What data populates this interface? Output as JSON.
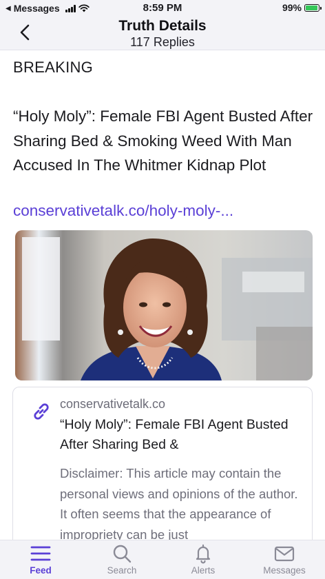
{
  "status_bar": {
    "back_app": "Messages",
    "time": "8:59 PM",
    "battery": "99%"
  },
  "header": {
    "title": "Truth Details",
    "subtitle": "117 Replies"
  },
  "post": {
    "breaking": "BREAKING",
    "headline": "“Holy Moly”: Female FBI Agent Busted After Sharing Bed & Smoking Weed With Man Accused In The Whitmer Kidnap Plot",
    "link_text": "conservativetalk.co/holy-moly-..."
  },
  "link_card": {
    "domain": "conservativetalk.co",
    "title": "“Holy Moly”: Female FBI Agent Busted After Sharing Bed &",
    "description": "Disclaimer: This article may contain the personal views and opinions of the author. It often seems that the appearance of impropriety can be just"
  },
  "tabs": [
    {
      "label": "Feed",
      "icon": "feed-icon",
      "active": true
    },
    {
      "label": "Search",
      "icon": "search-icon",
      "active": false
    },
    {
      "label": "Alerts",
      "icon": "bell-icon",
      "active": false
    },
    {
      "label": "Messages",
      "icon": "mail-icon",
      "active": false
    }
  ],
  "colors": {
    "accent": "#5a3fd6",
    "bar_background": "#f3f3f7",
    "battery_fill": "#35c759"
  }
}
